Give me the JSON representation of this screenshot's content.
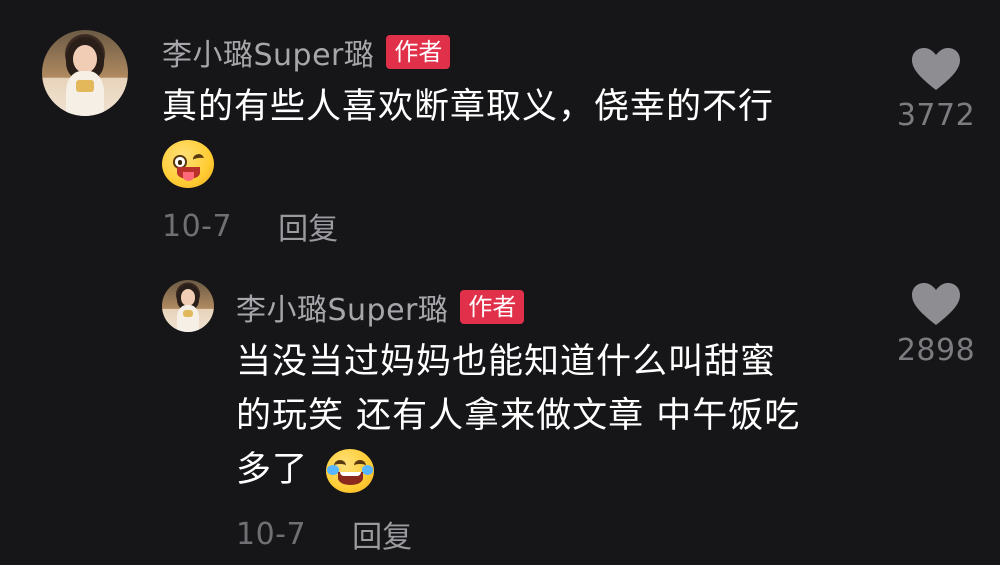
{
  "comments": [
    {
      "username": "李小璐Super璐",
      "badge": "作者",
      "text": "真的有些人喜欢断章取义，侥幸的不行",
      "emoji": "winking-tongue-emoji",
      "date": "10-7",
      "reply_label": "回复",
      "likes": "3772"
    },
    {
      "username": "李小璐Super璐",
      "badge": "作者",
      "text_lines": [
        "当没当过妈妈也能知道什么叫甜蜜",
        "的玩笑 还有人拿来做文章 中午饭吃",
        "多了"
      ],
      "emoji": "tears-of-joy-emoji",
      "date": "10-7",
      "reply_label": "回复",
      "likes": "2898"
    }
  ],
  "colors": {
    "background": "#161618",
    "badge": "#e0304a",
    "username": "#a7a7ab",
    "meta": "#6f6f74",
    "heart": "#8e8e92"
  }
}
